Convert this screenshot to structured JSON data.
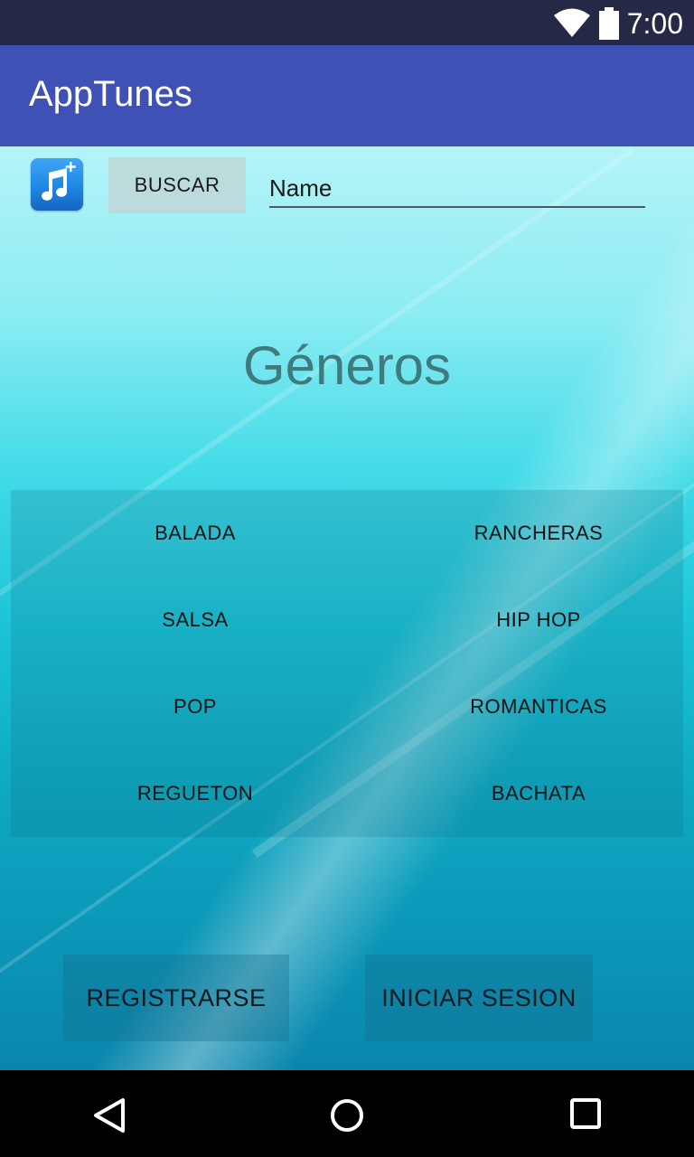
{
  "status_bar": {
    "time": "7:00",
    "wifi_icon": "wifi-icon",
    "battery_icon": "battery-icon"
  },
  "app_bar": {
    "title": "AppTunes"
  },
  "search": {
    "button_label": "BUSCAR",
    "input_value": "Name",
    "app_icon": "music-note-plus-icon"
  },
  "genres": {
    "title": "Géneros",
    "items": [
      "BALADA",
      "RANCHERAS",
      "SALSA",
      "HIP HOP",
      "POP",
      "ROMANTICAS",
      "REGUETON",
      "BACHATA"
    ]
  },
  "actions": {
    "register_label": "REGISTRARSE",
    "login_label": "INICIAR SESION"
  },
  "nav_bar": {
    "icons": [
      "back-icon",
      "home-icon",
      "recents-icon"
    ]
  },
  "colors": {
    "app_bar": "#3f51b5",
    "status_bar": "#262946",
    "title_text": "#3f7a7c"
  }
}
